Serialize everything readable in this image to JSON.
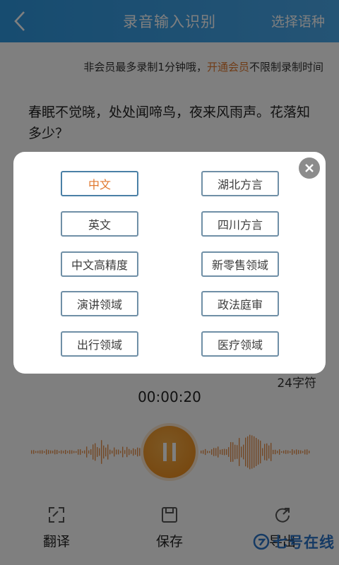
{
  "header": {
    "title": "录音输入识别",
    "language_button": "选择语种"
  },
  "notice": {
    "prefix": "非会员最多录制1分钟哦，",
    "vip_link": "开通会员",
    "suffix": "不限制录制时间"
  },
  "transcript": "春眠不觉晓，处处闻啼鸟，夜来风雨声。花落知多少？",
  "char_count": "24字符",
  "timer": "00:00:20",
  "bottom_bar": {
    "items": [
      {
        "label": "翻译",
        "icon": "translate-icon"
      },
      {
        "label": "保存",
        "icon": "save-icon"
      },
      {
        "label": "导出",
        "icon": "export-icon"
      }
    ]
  },
  "watermark": "七号在线",
  "language_dialog": {
    "options": [
      {
        "label": "中文",
        "selected": true
      },
      {
        "label": "湖北方言",
        "selected": false
      },
      {
        "label": "英文",
        "selected": false
      },
      {
        "label": "四川方言",
        "selected": false
      },
      {
        "label": "中文高精度",
        "selected": false
      },
      {
        "label": "新零售领域",
        "selected": false
      },
      {
        "label": "演讲领域",
        "selected": false
      },
      {
        "label": "政法庭审",
        "selected": false
      },
      {
        "label": "出行领域",
        "selected": false
      },
      {
        "label": "医疗领域",
        "selected": false
      }
    ]
  },
  "colors": {
    "header": "#2e98e0",
    "accent": "#e0782e",
    "record_button": "#f09324",
    "waveform": "#e8904a",
    "option_border": "#6f8fa6"
  }
}
